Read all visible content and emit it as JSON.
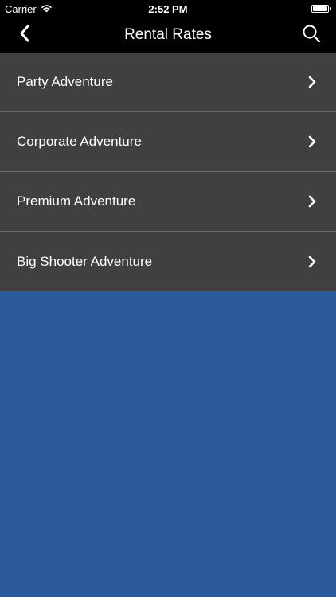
{
  "status_bar": {
    "carrier": "Carrier",
    "time": "2:52 PM",
    "battery_level": 1.0
  },
  "nav_bar": {
    "title": "Rental Rates",
    "back_icon": "chevron-left-icon",
    "search_icon": "search-icon"
  },
  "list": {
    "items": [
      {
        "label": "Party Adventure"
      },
      {
        "label": "Corporate Adventure"
      },
      {
        "label": "Premium Adventure"
      },
      {
        "label": "Big Shooter Adventure"
      }
    ]
  },
  "colors": {
    "background": "#2a5a9c",
    "list_background": "#404040",
    "separator": "#6a6a6a",
    "bar_background": "#000000",
    "text": "#ffffff"
  }
}
